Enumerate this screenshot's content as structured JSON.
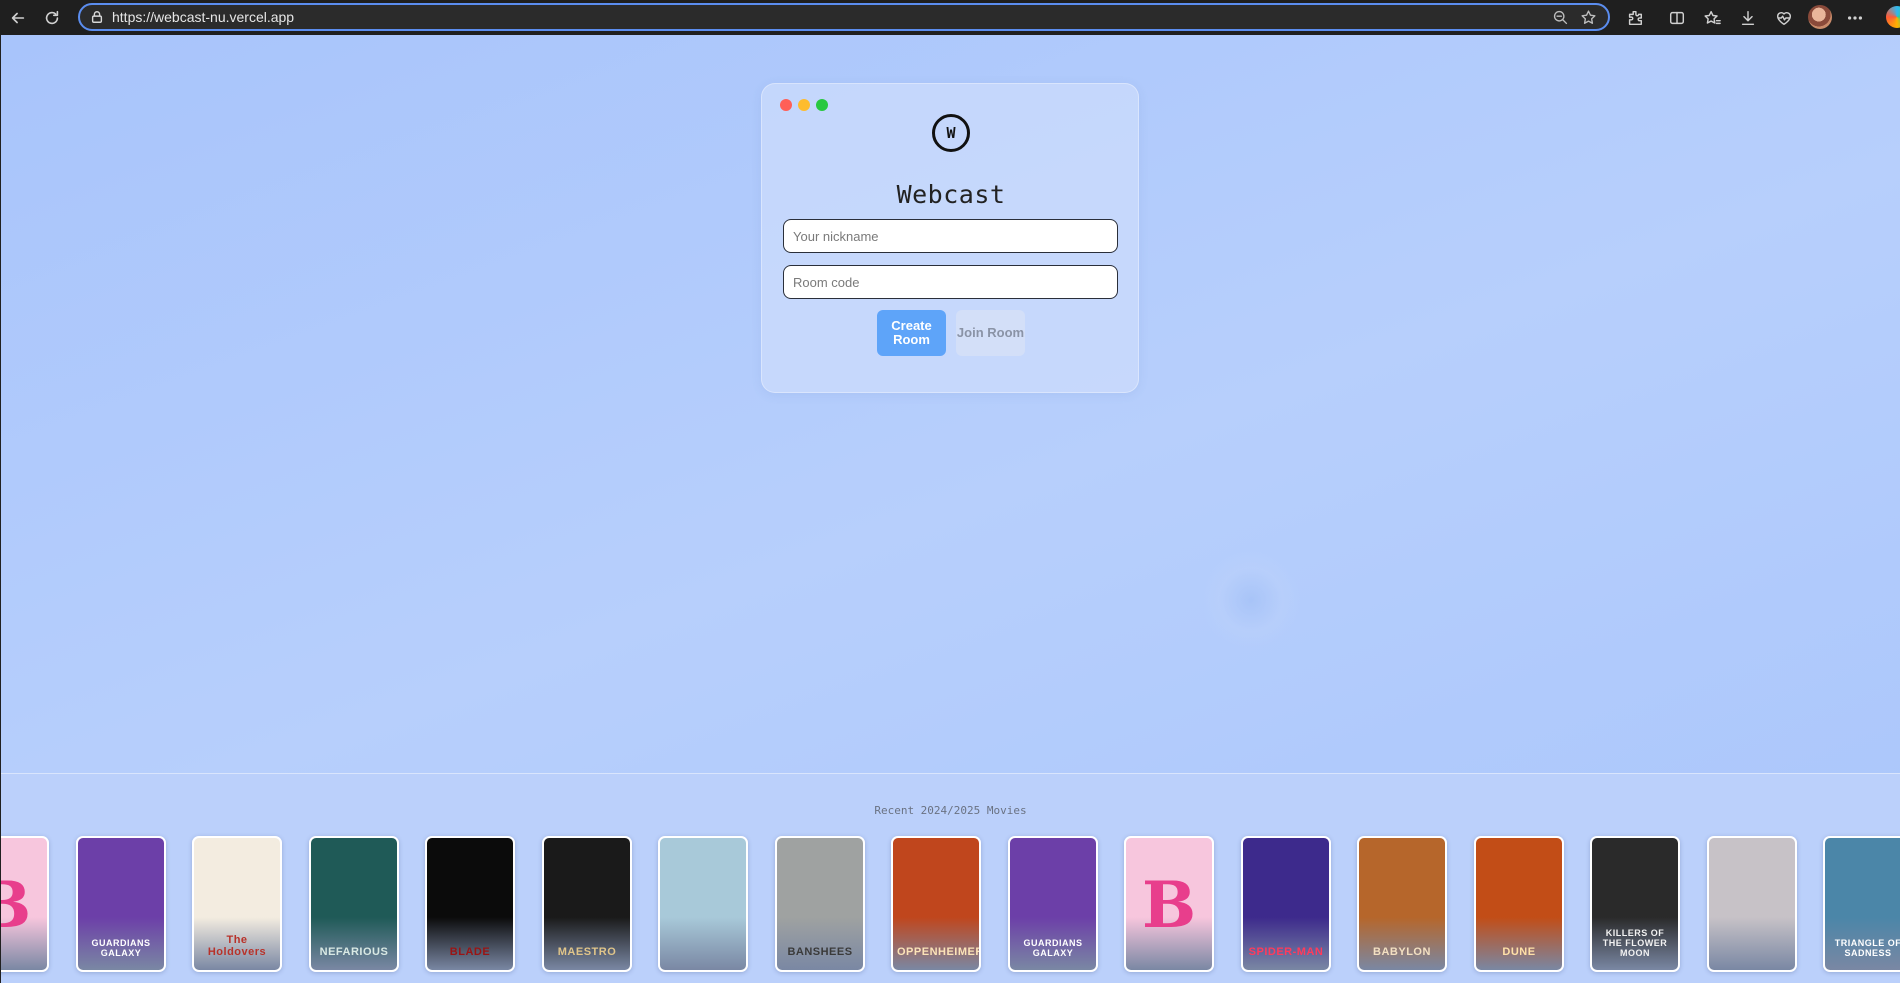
{
  "browser": {
    "url": "https://webcast-nu.vercel.app"
  },
  "app": {
    "logo_letter": "W",
    "title": "Webcast",
    "nickname_placeholder": "Your nickname",
    "room_code_placeholder": "Room code",
    "create_button": "Create Room",
    "join_button": "Join Room"
  },
  "movies": {
    "heading": "Recent 2024/2025 Movies",
    "posters": [
      {
        "name": "barbie",
        "text": "B",
        "bg": "#f7c6dd",
        "fg": "#e83e8c"
      },
      {
        "name": "guardians-of-the-galaxy",
        "text": "GUARDIANS GALAXY",
        "bg": "#6c3fa8",
        "fg": "#ffffff"
      },
      {
        "name": "the-holdovers",
        "text": "The Holdovers",
        "bg": "#f3ece0",
        "fg": "#b8322a"
      },
      {
        "name": "nefarious",
        "text": "NEFARIOUS",
        "bg": "#1f5a57",
        "fg": "#d9e9e4"
      },
      {
        "name": "blade",
        "text": "BLADE",
        "bg": "#0b0b0b",
        "fg": "#9a1414"
      },
      {
        "name": "maestro",
        "text": "MAESTRO",
        "bg": "#1a1a1a",
        "fg": "#e0c58a"
      },
      {
        "name": "greatest-beer-run",
        "text": "",
        "bg": "#a8c9d9",
        "fg": "#2b3b44"
      },
      {
        "name": "banshees-of-inisherin",
        "text": "BANSHEES",
        "bg": "#9fa2a1",
        "fg": "#3a3a3a"
      },
      {
        "name": "oppenheimer",
        "text": "OPPENHEIMER",
        "bg": "#c0461d",
        "fg": "#fbe3b8"
      },
      {
        "name": "guardians-of-the-galaxy-2",
        "text": "GUARDIANS GALAXY",
        "bg": "#6c3fa8",
        "fg": "#ffffff"
      },
      {
        "name": "barbie-2",
        "text": "B",
        "bg": "#f7c6dd",
        "fg": "#e83e8c"
      },
      {
        "name": "spider-verse",
        "text": "SPIDER-MAN",
        "bg": "#3d2a8c",
        "fg": "#ff3b5c"
      },
      {
        "name": "babylon",
        "text": "BABYLON",
        "bg": "#b6662b",
        "fg": "#f3e0c2"
      },
      {
        "name": "dune",
        "text": "DUNE",
        "bg": "#c24d17",
        "fg": "#ffe1a8"
      },
      {
        "name": "killers-of-the-flower-moon",
        "text": "KILLERS OF THE FLOWER MOON",
        "bg": "#2a2a2a",
        "fg": "#f2f2f2"
      },
      {
        "name": "poor-things",
        "text": "",
        "bg": "#c7c2c7",
        "fg": "#333333"
      },
      {
        "name": "triangle-of-sadness",
        "text": "TRIANGLE OF SADNESS",
        "bg": "#4b86a8",
        "fg": "#ffffff"
      }
    ]
  }
}
